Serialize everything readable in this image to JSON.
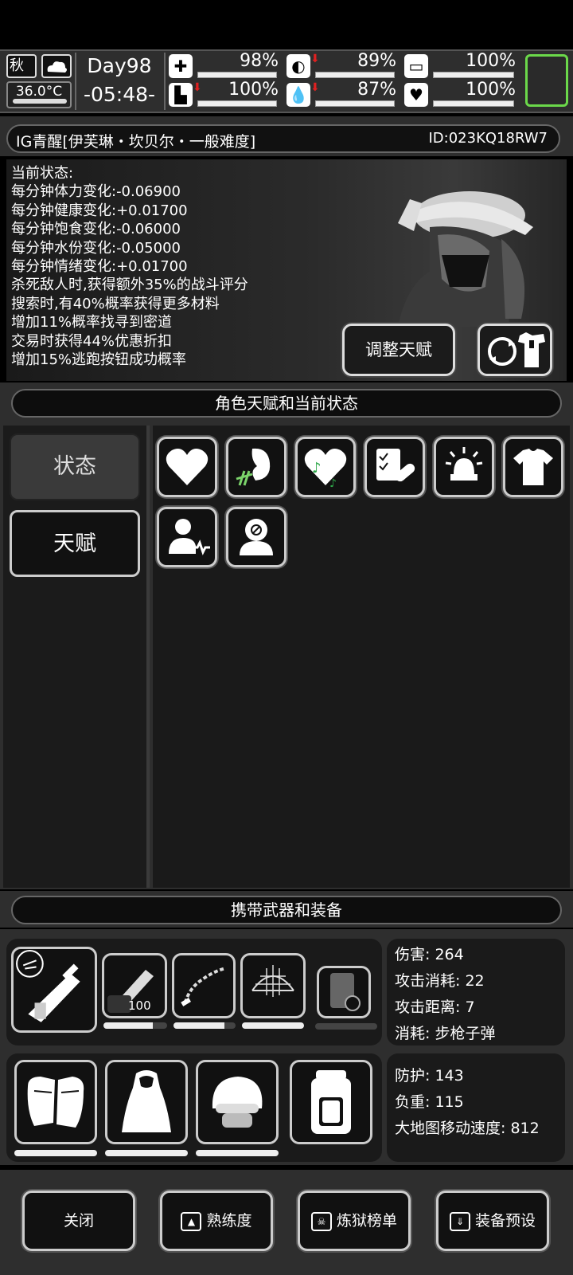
{
  "topbar": {
    "season": "秋",
    "temperature": "36.0°C",
    "day": "Day98",
    "time": "-05:48-",
    "stats": [
      {
        "icon": "medkit-icon",
        "value": "98%",
        "fill": 0.98,
        "arrow": false
      },
      {
        "icon": "stomach-icon",
        "value": "89%",
        "fill": 0.89,
        "arrow": true
      },
      {
        "icon": "battery-icon",
        "value": "100%",
        "fill": 1.0,
        "arrow": false
      },
      {
        "icon": "boot-icon",
        "value": "100%",
        "fill": 1.0,
        "arrow": true
      },
      {
        "icon": "water-drop-icon",
        "value": "87%",
        "fill": 0.87,
        "arrow": true
      },
      {
        "icon": "heart-icon",
        "value": "100%",
        "fill": 1.0,
        "arrow": false
      }
    ]
  },
  "character": {
    "name": "IG青醒[伊芙琳・坎贝尔・一般难度]",
    "id": "ID:023KQ18RW7"
  },
  "status": {
    "heading": "当前状态:",
    "lines": [
      "每分钟体力变化:-0.06900",
      "每分钟健康变化:+0.01700",
      "每分钟饱食变化:-0.06000",
      "每分钟水份变化:-0.05000",
      "每分钟情绪变化:+0.01700",
      "杀死敌人时,获得额外35%的战斗评分",
      "搜索时,有40%概率获得更多材料",
      "增加11%概率找寻到密道",
      "交易时获得44%优惠折扣",
      "增加15%逃跑按钮成功概率"
    ],
    "adjust_talent_label": "调整天赋"
  },
  "sections": {
    "talent_header": "角色天赋和当前状态",
    "equipment_header": "携带武器和装备"
  },
  "tabs": {
    "status": "状态",
    "talent": "天赋"
  },
  "weapon": {
    "ammo_count": "100",
    "stats": {
      "damage": "伤害: 264",
      "attack_cost": "攻击消耗: 22",
      "attack_range": "攻击距离: 7",
      "consume": "消耗: 步枪子弹"
    }
  },
  "armor": {
    "stats": {
      "defense": "防护: 143",
      "weight": "负重: 115",
      "map_speed": "大地图移动速度: 812"
    }
  },
  "bottom": {
    "close": "关闭",
    "proficiency": "熟练度",
    "ranking": "炼狱榜单",
    "preset": "装备预设"
  },
  "colors": {
    "accent_green": "#6bd84a",
    "arrow_red": "#e02020"
  }
}
